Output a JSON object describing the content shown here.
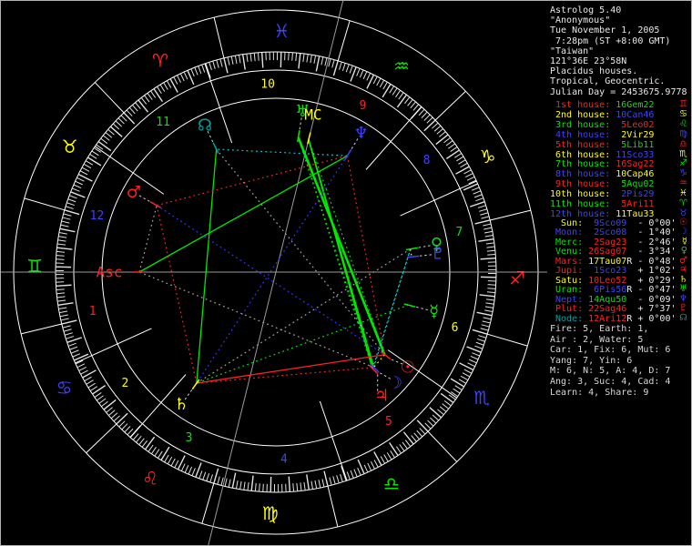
{
  "panel": {
    "header": [
      "Astrolog 5.40",
      "\"Anonymous\"",
      "Tue November 1, 2005",
      " 7:28pm (ST +8:00 GMT)",
      "\"Taiwan\"",
      "121°36E 23°58N",
      "Placidus houses.",
      "Tropical, Geocentric.",
      "Julian Day = 2453675.9778"
    ],
    "houses": [
      {
        "label": "1st house:",
        "value": "16Gem22",
        "sign": "♊",
        "label_color": "#ff2020",
        "value_color": "#00e800",
        "sign_color": "#ff2020"
      },
      {
        "label": "2nd house:",
        "value": "10Can46",
        "sign": "♋",
        "label_color": "#ffff00",
        "value_color": "#4040ff",
        "sign_color": "#ffff00"
      },
      {
        "label": "3rd house:",
        "value": "5Leo02",
        "sign": "♌",
        "label_color": "#00e800",
        "value_color": "#ff2020",
        "sign_color": "#00e800"
      },
      {
        "label": "4th house:",
        "value": "2Vir29",
        "sign": "♍",
        "label_color": "#4040ff",
        "value_color": "#ffff00",
        "sign_color": "#4040ff"
      },
      {
        "label": "5th house:",
        "value": "5Lib11",
        "sign": "♎",
        "label_color": "#ff2020",
        "value_color": "#00e800",
        "sign_color": "#ff2020"
      },
      {
        "label": "6th house:",
        "value": "11Sco33",
        "sign": "♏",
        "label_color": "#ffff00",
        "value_color": "#4040ff",
        "sign_color": "#ffff00"
      },
      {
        "label": "7th house:",
        "value": "16Sag22",
        "sign": "♐",
        "label_color": "#00e800",
        "value_color": "#ff2020",
        "sign_color": "#00e800"
      },
      {
        "label": "8th house:",
        "value": "10Cap46",
        "sign": "♑",
        "label_color": "#4040ff",
        "value_color": "#ffff00",
        "sign_color": "#4040ff"
      },
      {
        "label": "9th house:",
        "value": "5Aqu02",
        "sign": "♒",
        "label_color": "#ff2020",
        "value_color": "#00e800",
        "sign_color": "#ff2020"
      },
      {
        "label": "10th house:",
        "value": "2Pis29",
        "sign": "♓",
        "label_color": "#ffff00",
        "value_color": "#4040ff",
        "sign_color": "#ffff00"
      },
      {
        "label": "11th house:",
        "value": "5Ari11",
        "sign": "♈",
        "label_color": "#00e800",
        "value_color": "#ff2020",
        "sign_color": "#00e800"
      },
      {
        "label": "12th house:",
        "value": "11Tau33",
        "sign": "♉",
        "label_color": "#4040ff",
        "value_color": "#ffff00",
        "sign_color": "#4040ff"
      }
    ],
    "planets": [
      {
        "label": "Sun:",
        "value": "9Sco09",
        "flag": "",
        "motion": "- 0°00'",
        "glyph": "☉",
        "label_color": "#ffff00",
        "value_color": "#4040ff",
        "glyph_color": "#ff2020"
      },
      {
        "label": "Moon:",
        "value": "2Sco08",
        "flag": "",
        "motion": "- 1°40'",
        "glyph": "☽",
        "label_color": "#4040ff",
        "value_color": "#4040ff",
        "glyph_color": "#4040ff"
      },
      {
        "label": "Merc:",
        "value": "2Sag23",
        "flag": "",
        "motion": "- 2°46'",
        "glyph": "☿",
        "label_color": "#00e800",
        "value_color": "#ff2020",
        "glyph_color": "#ffff00"
      },
      {
        "label": "Venu:",
        "value": "26Sag07",
        "flag": "",
        "motion": "- 3°34'",
        "glyph": "♀",
        "label_color": "#00e800",
        "value_color": "#ff2020",
        "glyph_color": "#00e800"
      },
      {
        "label": "Mars:",
        "value": "17Tau07",
        "flag": "R",
        "motion": "- 0°48'",
        "glyph": "♂",
        "label_color": "#ff2020",
        "value_color": "#ffff00",
        "glyph_color": "#ff2020"
      },
      {
        "label": "Jupi:",
        "value": "1Sco23",
        "flag": "",
        "motion": "+ 1°02'",
        "glyph": "♃",
        "label_color": "#ff2020",
        "value_color": "#4040ff",
        "glyph_color": "#ff2020"
      },
      {
        "label": "Satu:",
        "value": "10Leo52",
        "flag": "",
        "motion": "+ 0°29'",
        "glyph": "♄",
        "label_color": "#ffff00",
        "value_color": "#ff2020",
        "glyph_color": "#ffff00"
      },
      {
        "label": "Uran:",
        "value": "6Pis56",
        "flag": "R",
        "motion": "- 0°47'",
        "glyph": "♅",
        "label_color": "#00e800",
        "value_color": "#4040ff",
        "glyph_color": "#00e800"
      },
      {
        "label": "Nept:",
        "value": "14Aqu50",
        "flag": "",
        "motion": "- 0°09'",
        "glyph": "♆",
        "label_color": "#4040ff",
        "value_color": "#00e800",
        "glyph_color": "#4040ff"
      },
      {
        "label": "Plut:",
        "value": "22Sag46",
        "flag": "",
        "motion": "+ 7°37'",
        "glyph": "♇",
        "label_color": "#ff2020",
        "value_color": "#ff2020",
        "glyph_color": "#ff2020"
      },
      {
        "label": "Node:",
        "value": "12Ari12",
        "flag": "R",
        "motion": "+ 0°00'",
        "glyph": "☊",
        "label_color": "#00a0a0",
        "value_color": "#ff2020",
        "glyph_color": "#00a0a0"
      }
    ],
    "stats": [
      "Fire: 5, Earth: 1,",
      "Air : 2, Water: 5",
      "Car: 1, Fix: 6, Mut: 6",
      "Yang: 7, Yin: 6",
      "M: 6, N: 5, A: 4, D: 7",
      "Ang: 3, Suc: 4, Cad: 4",
      "Learn: 4, Share: 9"
    ]
  },
  "wheel": {
    "ascendant_longitude": 76.367,
    "house_cusps": [
      76.367,
      100.767,
      125.033,
      152.483,
      185.183,
      221.55,
      256.367,
      280.767,
      305.033,
      332.483,
      5.183,
      41.55
    ],
    "house_number_colors": [
      "#ff2020",
      "#ffff00",
      "#00e800",
      "#4040ff",
      "#ff2020",
      "#ffff00",
      "#00e800",
      "#4040ff",
      "#ff2020",
      "#ffff00",
      "#00e800",
      "#4040ff"
    ],
    "signs": [
      {
        "name": "Aries",
        "glyph": "♈",
        "color": "#ff2020"
      },
      {
        "name": "Taurus",
        "glyph": "♉",
        "color": "#ffff00"
      },
      {
        "name": "Gemini",
        "glyph": "♊",
        "color": "#00e800"
      },
      {
        "name": "Cancer",
        "glyph": "♋",
        "color": "#4040ff"
      },
      {
        "name": "Leo",
        "glyph": "♌",
        "color": "#ff2020"
      },
      {
        "name": "Virgo",
        "glyph": "♍",
        "color": "#ffff00"
      },
      {
        "name": "Libra",
        "glyph": "♎",
        "color": "#00e800"
      },
      {
        "name": "Scorpio",
        "glyph": "♏",
        "color": "#4040ff"
      },
      {
        "name": "Sagittarius",
        "glyph": "♐",
        "color": "#ff2020"
      },
      {
        "name": "Capricorn",
        "glyph": "♑",
        "color": "#ffff00"
      },
      {
        "name": "Aquarius",
        "glyph": "♒",
        "color": "#00e800"
      },
      {
        "name": "Pisces",
        "glyph": "♓",
        "color": "#4040ff"
      }
    ],
    "planets": [
      {
        "name": "Sun",
        "glyph": "☉",
        "color": "#ff2020",
        "lon": 219.15,
        "glyph_angle": 36
      },
      {
        "name": "Moon",
        "glyph": "☽",
        "color": "#4040ff",
        "lon": 212.133,
        "glyph_angle": 43
      },
      {
        "name": "Mercury",
        "glyph": "☿",
        "color": "#00e800",
        "lon": 242.383
      },
      {
        "name": "Venus",
        "glyph": "♀",
        "color": "#00e800",
        "lon": 266.117
      },
      {
        "name": "Mars",
        "glyph": "♂",
        "color": "#ff2020",
        "lon": 47.117
      },
      {
        "name": "Jupiter",
        "glyph": "♃",
        "color": "#ff2020",
        "lon": 211.383,
        "glyph_angle": 49.5
      },
      {
        "name": "Saturn",
        "glyph": "♄",
        "color": "#ffff00",
        "lon": 130.867
      },
      {
        "name": "Uranus",
        "glyph": "♅",
        "color": "#00e800",
        "lon": 336.933
      },
      {
        "name": "Neptune",
        "glyph": "♆",
        "color": "#4040ff",
        "lon": 314.833
      },
      {
        "name": "Pluto",
        "glyph": "♇",
        "color": "#4040ff",
        "lon": 262.767
      },
      {
        "name": "Node",
        "glyph": "☊",
        "color": "#00a0a0",
        "lon": 12.2
      }
    ],
    "angles": [
      {
        "name": "Asc",
        "label": "Asc",
        "color": "#ff2020",
        "lon": 76.367
      },
      {
        "name": "MC",
        "label": "MC",
        "color": "#ffff00",
        "lon": 332.483
      }
    ],
    "aspects": [
      {
        "a": "Uranus",
        "b": "Sun",
        "color": "#00e800",
        "style": "solid",
        "width": 2.6
      },
      {
        "a": "MC",
        "b": "Moon",
        "color": "#00e800",
        "style": "solid",
        "width": 1.6
      },
      {
        "a": "MC",
        "b": "Jupiter",
        "color": "#00e800",
        "style": "solid",
        "width": 1.6
      },
      {
        "a": "Saturn",
        "b": "Node",
        "color": "#00e800",
        "style": "solid",
        "width": 1.3
      },
      {
        "a": "Asc",
        "b": "Neptune",
        "color": "#00e800",
        "style": "solid",
        "width": 1.3
      },
      {
        "a": "Saturn",
        "b": "Sun",
        "color": "#ff2020",
        "style": "solid",
        "width": 1.3
      },
      {
        "a": "Uranus",
        "b": "Moon",
        "color": "#00e800",
        "style": "dotted"
      },
      {
        "a": "Uranus",
        "b": "Jupiter",
        "color": "#00e800",
        "style": "dotted"
      },
      {
        "a": "MC",
        "b": "Sun",
        "color": "#00e800",
        "style": "dotted"
      },
      {
        "a": "Mercury",
        "b": "Saturn",
        "color": "#00e800",
        "style": "dotted"
      },
      {
        "a": "Mars",
        "b": "Saturn",
        "color": "#ff2020",
        "style": "dotted"
      },
      {
        "a": "Mars",
        "b": "Neptune",
        "color": "#ff2020",
        "style": "dotted"
      },
      {
        "a": "Neptune",
        "b": "Sun",
        "color": "#ff2020",
        "style": "dotted"
      },
      {
        "a": "Saturn",
        "b": "Moon",
        "color": "#ff2020",
        "style": "dotted"
      },
      {
        "a": "Mars",
        "b": "Sun",
        "color": "#3434ff",
        "style": "dotted"
      },
      {
        "a": "Neptune",
        "b": "Saturn",
        "color": "#3434ff",
        "style": "dotted"
      },
      {
        "a": "Moon",
        "b": "Venus",
        "color": "#00d8d8",
        "style": "dotted"
      },
      {
        "a": "Jupiter",
        "b": "Venus",
        "color": "#00d8d8",
        "style": "dotted"
      },
      {
        "a": "Neptune",
        "b": "Node",
        "color": "#00d8d8",
        "style": "dotted"
      },
      {
        "a": "Venus",
        "b": "Pluto",
        "color": "#ffff00",
        "style": "dotted"
      },
      {
        "a": "Sun",
        "b": "Moon",
        "color": "#ffff00",
        "style": "dotted"
      },
      {
        "a": "Node",
        "b": "Sun",
        "color": "#a0a0a0",
        "style": "dotted"
      },
      {
        "a": "Asc",
        "b": "Mars",
        "color": "#a0a0a0",
        "style": "dotted"
      },
      {
        "a": "Saturn",
        "b": "Venus",
        "color": "#a0a0a0",
        "style": "dotted"
      },
      {
        "a": "Moon",
        "b": "Asc",
        "color": "#a0a0a0",
        "style": "dotted"
      }
    ],
    "line_colors": {
      "circle": "#ffffff",
      "ticks": "#e0e0e0",
      "axes": "#9a9a9a",
      "pointer": "#cfcfcf"
    }
  }
}
